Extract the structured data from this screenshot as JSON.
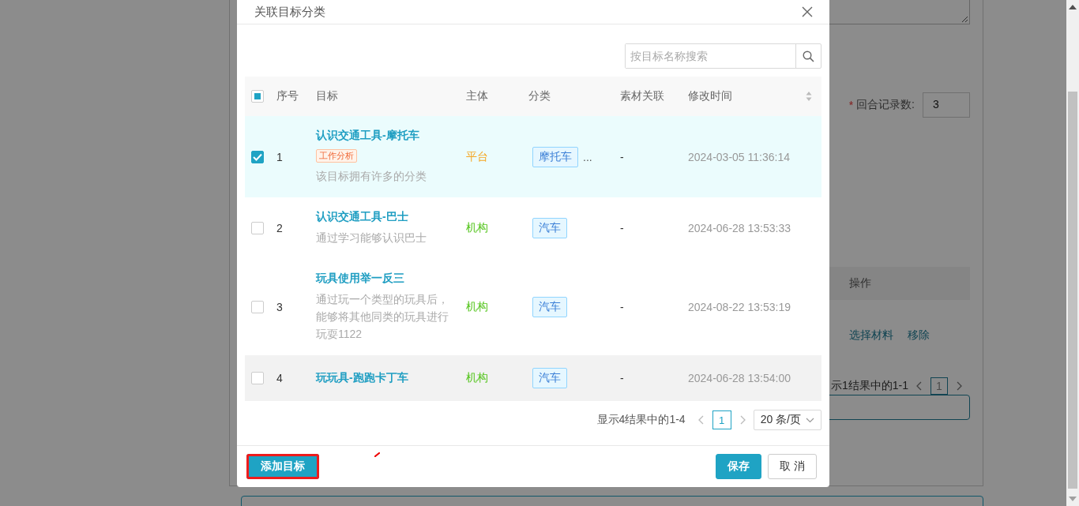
{
  "background_page": {
    "form_field": {
      "required": true,
      "required_mark": "*",
      "label": "回合记录数:",
      "value": "3"
    },
    "table": {
      "columns": [
        "操作"
      ],
      "row_actions": [
        "选择材料",
        "移除"
      ]
    },
    "pagination": {
      "summary": "示1结果中的1-1",
      "pages": [
        {
          "label": "1",
          "selected": true
        }
      ]
    }
  },
  "dialog": {
    "title": "关联目标分类",
    "search": {
      "placeholder": "按目标名称搜索"
    },
    "table": {
      "select_all": {
        "checked": false,
        "indeterminate": true
      },
      "columns": [
        {
          "label": "序号",
          "sortable": false
        },
        {
          "label": "目标",
          "sortable": false
        },
        {
          "label": "主体",
          "sortable": false
        },
        {
          "label": "分类",
          "sortable": false
        },
        {
          "label": "素材关联",
          "sortable": false
        },
        {
          "label": "修改时间",
          "sortable": true
        }
      ],
      "rows": [
        {
          "selected": true,
          "hovered": false,
          "index": "1",
          "title": "认识交通工具-摩托车",
          "tag": "工作分析",
          "description": "该目标拥有许多的分类",
          "subject": "平台",
          "color": "#f5a623",
          "category": "摩托车",
          "more": "...",
          "materials": "-",
          "modified": "2024-03-05 11:36:14"
        },
        {
          "selected": false,
          "hovered": false,
          "index": "2",
          "title": "认识交通工具-巴士",
          "description": "通过学习能够认识巴士",
          "subject": "机构",
          "color": "#52c41a",
          "category": "汽车",
          "materials": "-",
          "modified": "2024-06-28 13:53:33"
        },
        {
          "selected": false,
          "hovered": false,
          "index": "3",
          "title": "玩具使用举一反三",
          "description": "通过玩一个类型的玩具后，能够将其他同类的玩具进行玩耍1122",
          "subject": "机构",
          "color": "#52c41a",
          "category": "汽车",
          "materials": "-",
          "modified": "2024-08-22 13:53:19"
        },
        {
          "selected": false,
          "hovered": true,
          "index": "4",
          "title": "玩玩具-跑跑卡丁车",
          "subject": "机构",
          "color": "#52c41a",
          "category": "汽车",
          "materials": "-",
          "modified": "2024-06-28 13:54:00"
        }
      ]
    },
    "pagination": {
      "summary": "显示4结果中的1-4",
      "pages": [
        {
          "label": "1",
          "selected": true
        }
      ],
      "page_size": "20 条/页"
    },
    "footer": {
      "left_buttons": [
        {
          "label": "添加目标",
          "kind": "primary",
          "highlighted": true
        }
      ],
      "right_buttons": [
        {
          "label": "保存",
          "kind": "primary",
          "highlighted": false
        },
        {
          "label": "取 消",
          "kind": "default",
          "highlighted": false
        }
      ]
    }
  }
}
